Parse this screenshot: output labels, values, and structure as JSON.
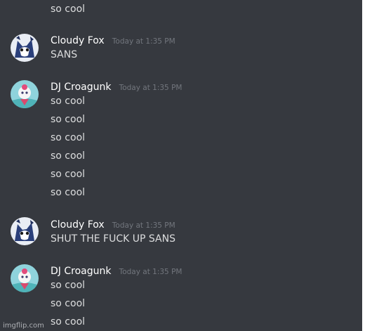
{
  "top_line": "so cool",
  "messages": [
    {
      "author": "Cloudy Fox",
      "time": "Today at 1:35 PM",
      "avatar": "fox-avatar",
      "lines": [
        "SANS"
      ]
    },
    {
      "author": "DJ Croagunk",
      "time": "Today at 1:35 PM",
      "avatar": "croagunk-avatar",
      "lines": [
        "so cool",
        "so cool",
        "so cool",
        "so cool",
        "so cool",
        "so cool"
      ]
    },
    {
      "author": "Cloudy Fox",
      "time": "Today at 1:35 PM",
      "avatar": "fox-avatar",
      "lines": [
        "SHUT THE FUCK UP SANS"
      ]
    },
    {
      "author": "DJ Croagunk",
      "time": "Today at 1:35 PM",
      "avatar": "croagunk-avatar",
      "lines": [
        "so cool",
        "so cool",
        "so cool"
      ]
    }
  ],
  "watermark": "imgflip.com",
  "colors": {
    "background": "#36393f",
    "text": "#dcddde",
    "username": "#ffffff",
    "timestamp": "#72767d"
  }
}
